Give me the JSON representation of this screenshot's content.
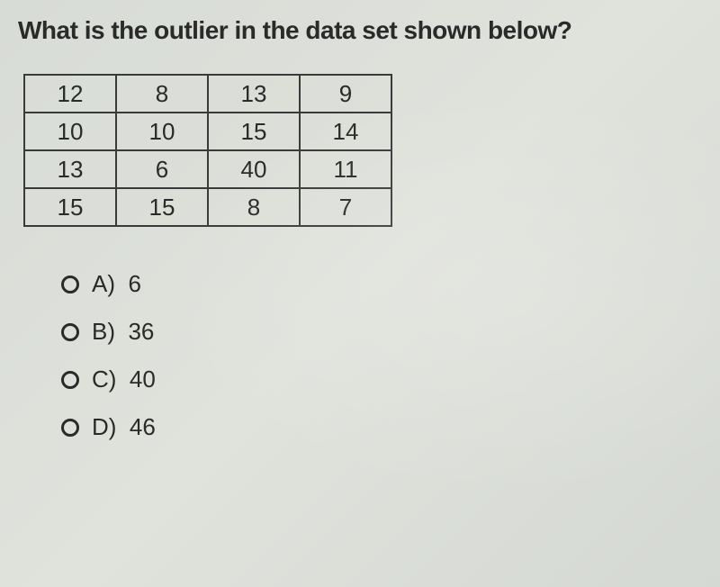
{
  "question": "What is the outlier in the data set shown below?",
  "table": {
    "rows": [
      [
        "12",
        "8",
        "13",
        "9"
      ],
      [
        "10",
        "10",
        "15",
        "14"
      ],
      [
        "13",
        "6",
        "40",
        "11"
      ],
      [
        "15",
        "15",
        "8",
        "7"
      ]
    ]
  },
  "options": [
    {
      "letter": "A)",
      "value": "6"
    },
    {
      "letter": "B)",
      "value": "36"
    },
    {
      "letter": "C)",
      "value": "40"
    },
    {
      "letter": "D)",
      "value": "46"
    }
  ]
}
